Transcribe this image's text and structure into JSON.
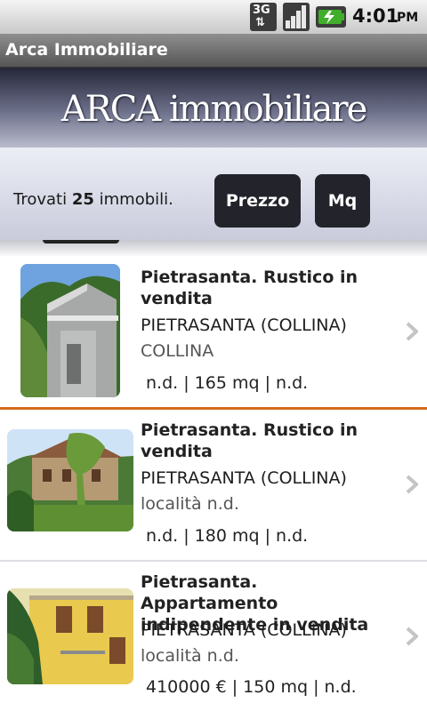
{
  "status_bar": {
    "network": "3G",
    "time": "4:01",
    "ampm": "PM",
    "icons": [
      "3g-data-icon",
      "signal-strength-icon",
      "battery-charging-icon"
    ]
  },
  "app": {
    "title": "Arca Immobiliare",
    "banner_logo": "ARCA immobiliare"
  },
  "filter": {
    "count_prefix": "Trovati ",
    "count": "25",
    "count_suffix": " immobili.",
    "sort_price_label": "Prezzo",
    "sort_area_label": "Mq"
  },
  "listings": [
    {
      "title": "Pietrasanta. Rustico in vendita",
      "location": "PIETRASANTA (COLLINA)",
      "zone": "COLLINA",
      "price": "n.d.",
      "area": "165 mq",
      "rooms": "n.d."
    },
    {
      "title": "Pietrasanta. Rustico in vendita",
      "location": "PIETRASANTA (COLLINA)",
      "zone": "località n.d.",
      "price": "n.d.",
      "area": "180 mq",
      "rooms": "n.d."
    },
    {
      "title": "Pietrasanta. Appartamento indipendente in vendita",
      "location": "PIETRASANTA (COLLINA)",
      "zone": "località n.d.",
      "price": "410000 €",
      "area": "150 mq",
      "rooms": "n.d."
    }
  ],
  "colors": {
    "selected_separator": "#d46a1a",
    "button_bg": "#23232b",
    "banner_dark": "#242638"
  }
}
